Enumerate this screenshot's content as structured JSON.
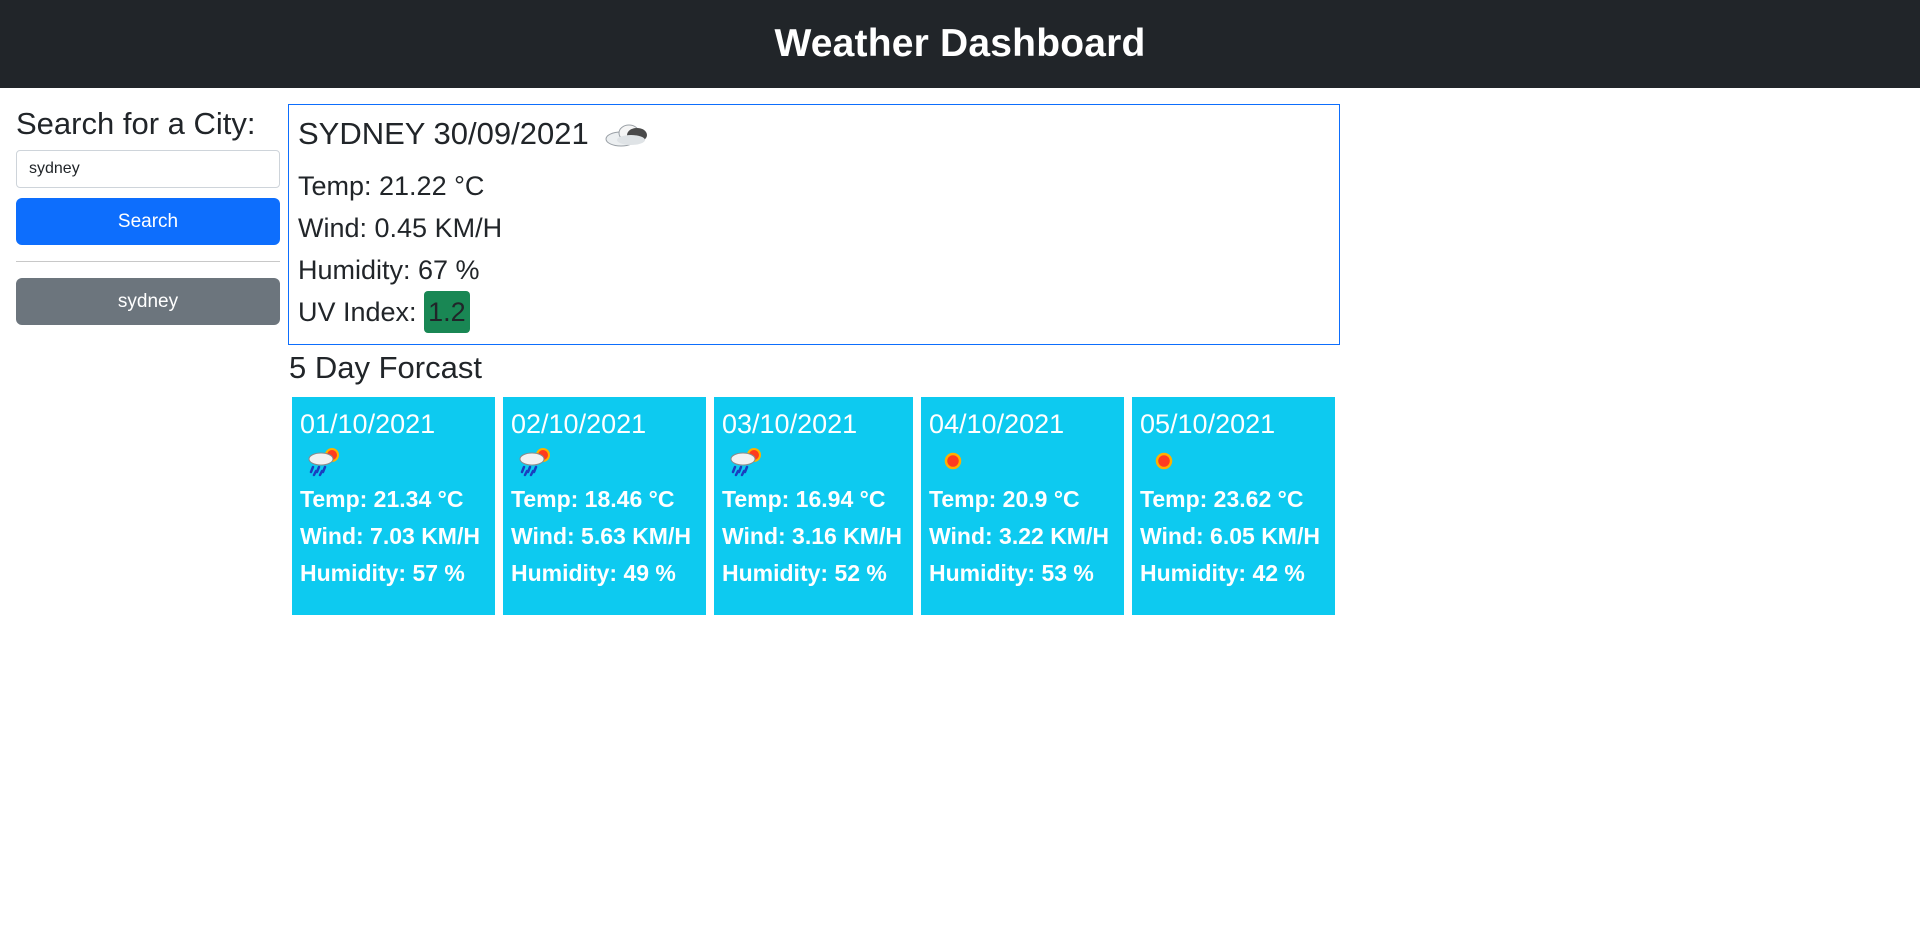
{
  "header": {
    "title": "Weather Dashboard"
  },
  "sidebar": {
    "heading": "Search for a City:",
    "search_value": "sydney",
    "search_button": "Search",
    "history": [
      {
        "label": "sydney"
      }
    ]
  },
  "current": {
    "city_date": "SYDNEY 30/09/2021",
    "icon": "cloud-icon",
    "temp": "Temp: 21.22 °C",
    "wind": "Wind: 0.45 KM/H",
    "humidity": "Humidity: 67 %",
    "uv_label": "UV Index:",
    "uv_value": "1.2",
    "uv_color": "#198754"
  },
  "forecast": {
    "title": "5 Day Forcast",
    "days": [
      {
        "date": "01/10/2021",
        "icon": "rain-sun-icon",
        "temp": "Temp: 21.34 °C",
        "wind": "Wind: 7.03 KM/H",
        "humidity": "Humidity: 57 %"
      },
      {
        "date": "02/10/2021",
        "icon": "rain-sun-icon",
        "temp": "Temp: 18.46 °C",
        "wind": "Wind: 5.63 KM/H",
        "humidity": "Humidity: 49 %"
      },
      {
        "date": "03/10/2021",
        "icon": "rain-sun-icon",
        "temp": "Temp: 16.94 °C",
        "wind": "Wind: 3.16 KM/H",
        "humidity": "Humidity: 52 %"
      },
      {
        "date": "04/10/2021",
        "icon": "sun-icon",
        "temp": "Temp: 20.9 °C",
        "wind": "Wind: 3.22 KM/H",
        "humidity": "Humidity: 53 %"
      },
      {
        "date": "05/10/2021",
        "icon": "sun-icon",
        "temp": "Temp: 23.62 °C",
        "wind": "Wind: 6.05 KM/H",
        "humidity": "Humidity: 42 %"
      }
    ]
  },
  "colors": {
    "header_bg": "#212529",
    "primary": "#0d6efd",
    "secondary": "#6c757d",
    "card_bg": "#0dcaf0",
    "uv_good": "#198754"
  }
}
